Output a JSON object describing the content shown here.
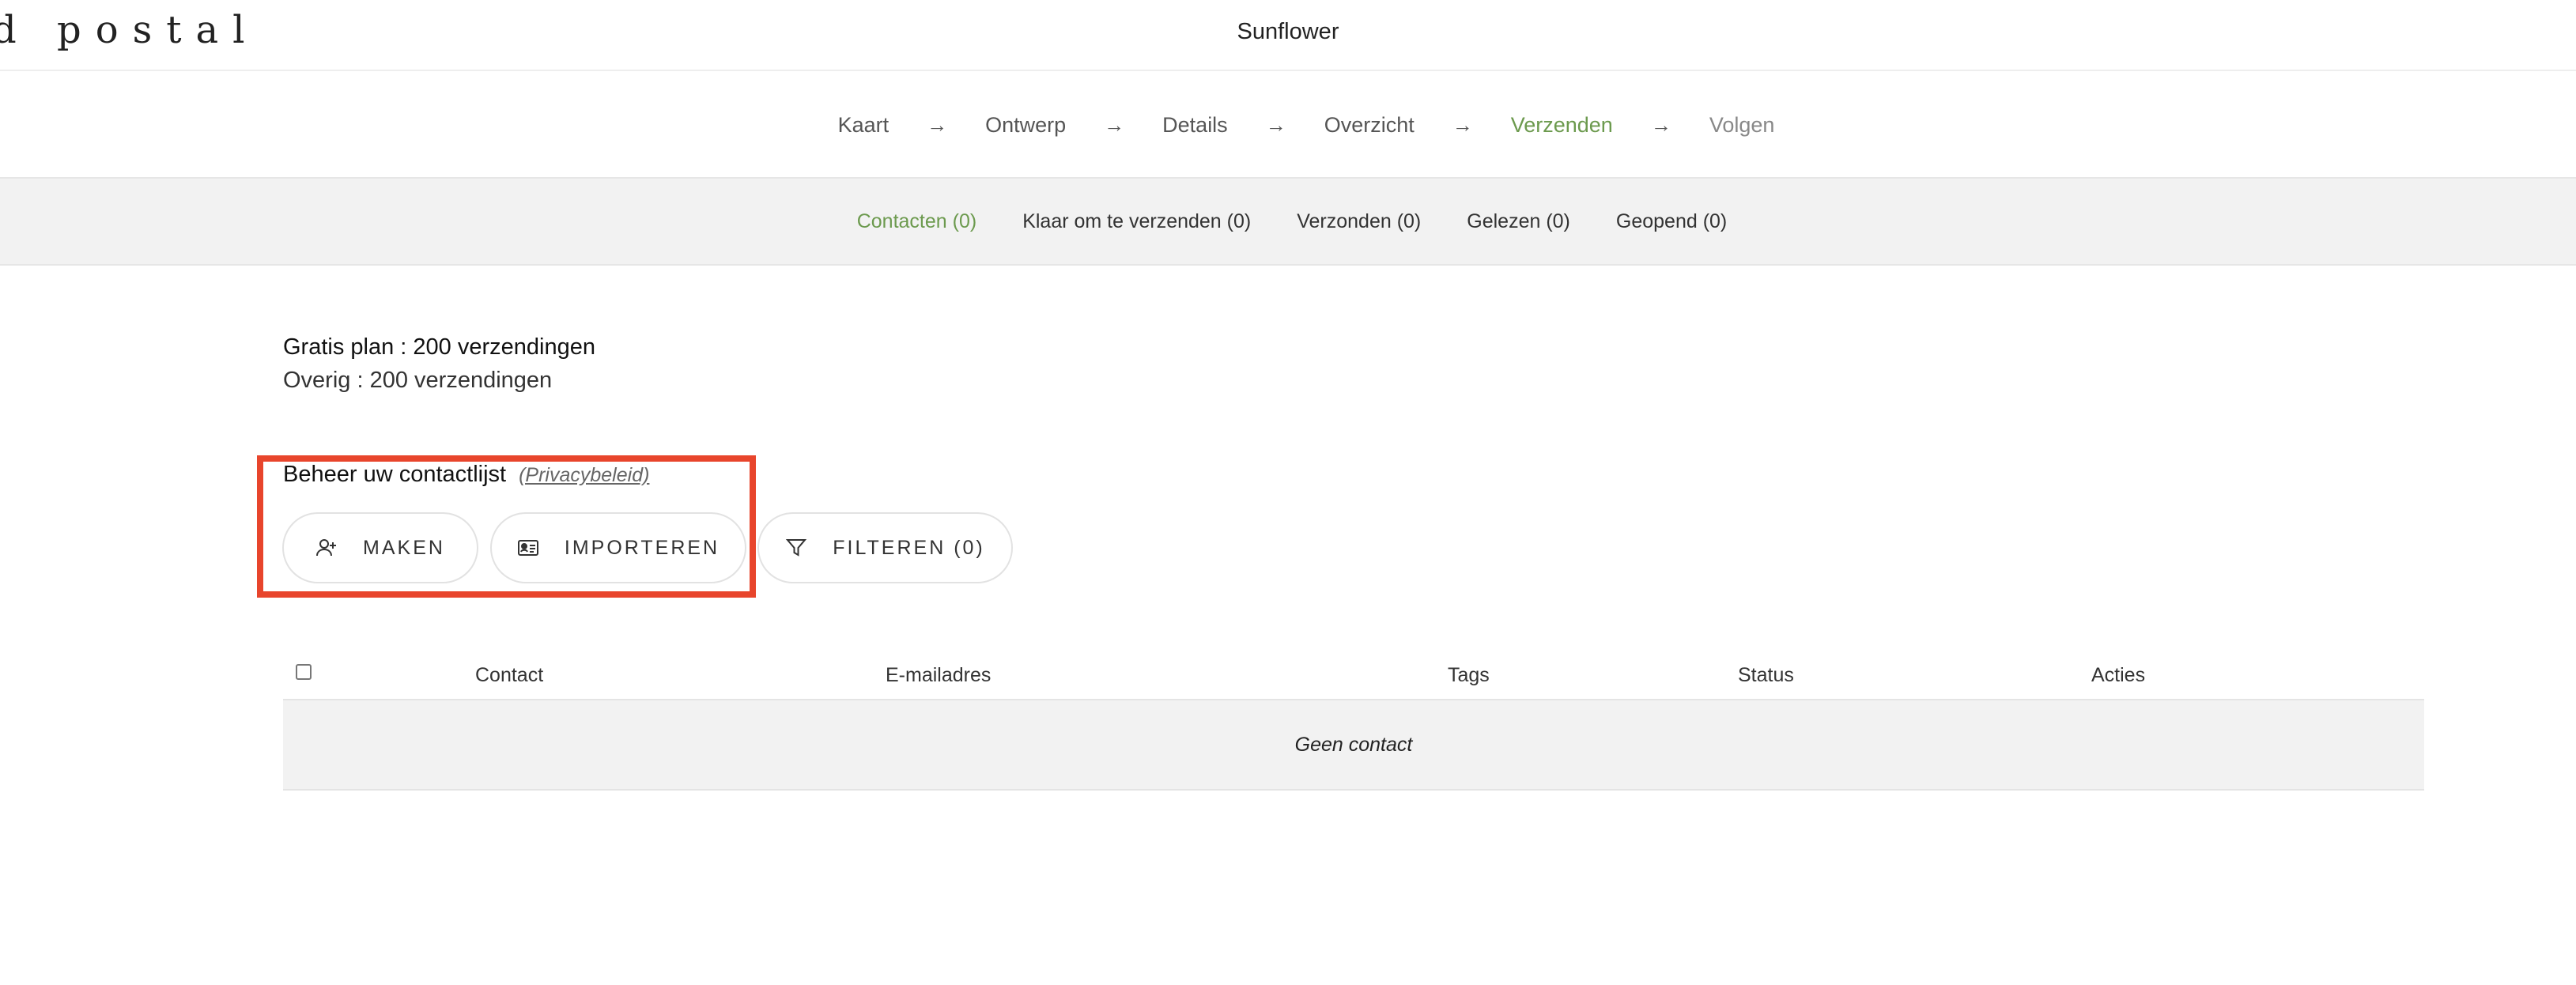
{
  "header": {
    "logo_text": "d postal",
    "title": "Sunflower"
  },
  "steps": [
    {
      "label": "Kaart"
    },
    {
      "label": "Ontwerp"
    },
    {
      "label": "Details"
    },
    {
      "label": "Overzicht"
    },
    {
      "label": "Verzenden"
    },
    {
      "label": "Volgen"
    }
  ],
  "step_arrow": "→",
  "subtabs": [
    {
      "label": "Contacten (0)"
    },
    {
      "label": "Klaar om te verzenden (0)"
    },
    {
      "label": "Verzonden (0)"
    },
    {
      "label": "Gelezen (0)"
    },
    {
      "label": "Geopend (0)"
    }
  ],
  "plan": {
    "name": "Gratis plan : 200 verzendingen",
    "remaining": "Overig : 200 verzendingen"
  },
  "contact_list": {
    "title": "Beheer uw contactlijst",
    "privacy_link": "(Privacybeleid)",
    "buttons": {
      "create": "MAKEN",
      "import": "IMPORTEREN",
      "filter": "FILTEREN (0)"
    }
  },
  "table": {
    "columns": [
      "Contact",
      "E-mailadres",
      "Tags",
      "Status",
      "Acties"
    ],
    "empty_text": "Geen contact"
  },
  "colors": {
    "accent": "#6c9a4e",
    "highlight": "#e8452c"
  }
}
